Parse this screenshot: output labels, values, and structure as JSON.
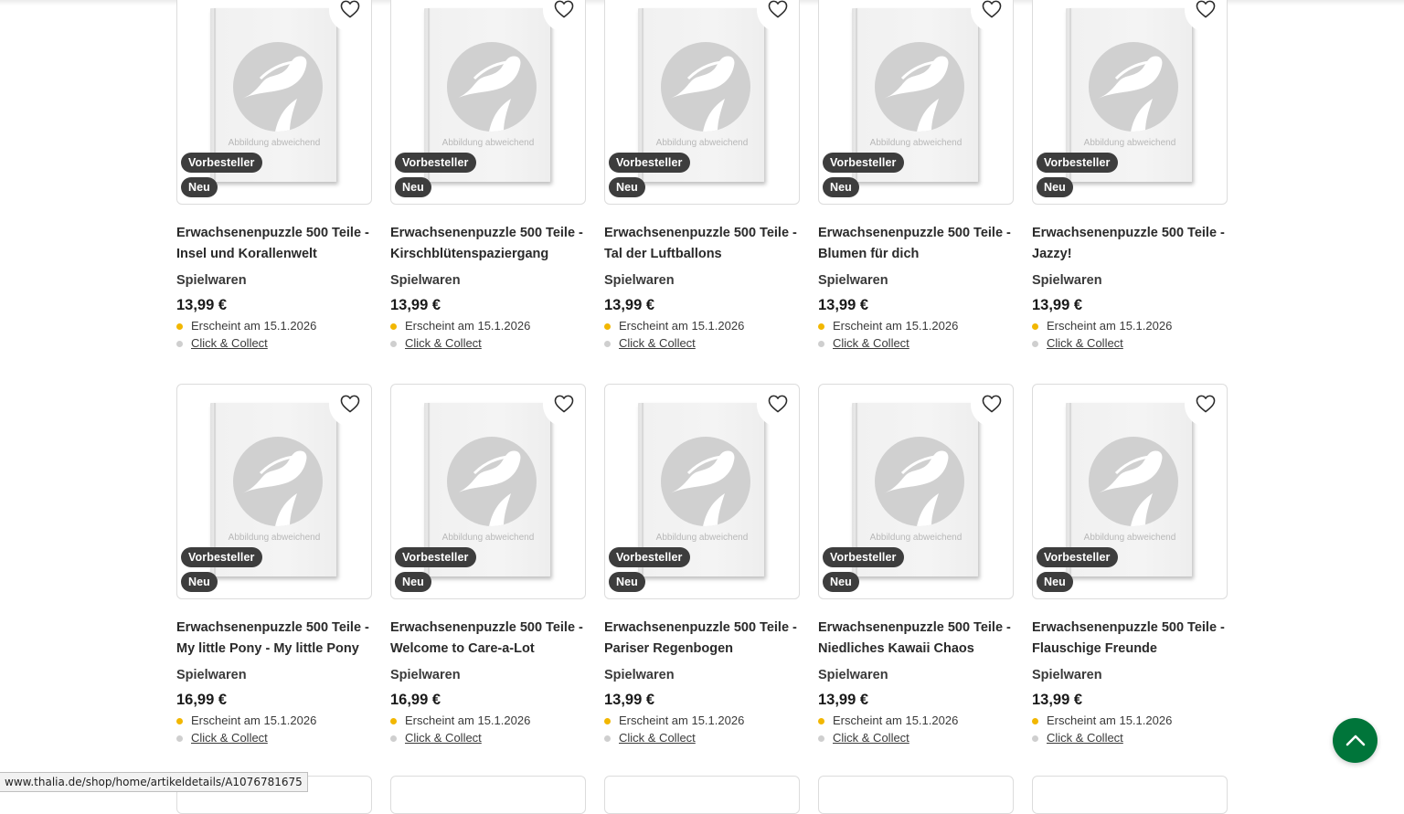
{
  "products": [
    [
      {
        "title": [
          "Erwachsenenpuzzle 500 Teile -",
          "Insel und Korallenwelt"
        ],
        "category": "Spielwaren",
        "price": "13,99 €",
        "availability": "Erscheint am 15.1.2026",
        "collect": "Click & Collect",
        "badges": [
          "Vorbesteller",
          "Neu"
        ],
        "placeholder": "Abbildung abweichend"
      },
      {
        "title": [
          "Erwachsenenpuzzle 500 Teile -",
          "Kirschblütenspaziergang"
        ],
        "category": "Spielwaren",
        "price": "13,99 €",
        "availability": "Erscheint am 15.1.2026",
        "collect": "Click & Collect",
        "badges": [
          "Vorbesteller",
          "Neu"
        ],
        "placeholder": "Abbildung abweichend"
      },
      {
        "title": [
          "Erwachsenenpuzzle 500 Teile -",
          "Tal der Luftballons"
        ],
        "category": "Spielwaren",
        "price": "13,99 €",
        "availability": "Erscheint am 15.1.2026",
        "collect": "Click & Collect",
        "badges": [
          "Vorbesteller",
          "Neu"
        ],
        "placeholder": "Abbildung abweichend"
      },
      {
        "title": [
          "Erwachsenenpuzzle 500 Teile -",
          "Blumen für dich"
        ],
        "category": "Spielwaren",
        "price": "13,99 €",
        "availability": "Erscheint am 15.1.2026",
        "collect": "Click & Collect",
        "badges": [
          "Vorbesteller",
          "Neu"
        ],
        "placeholder": "Abbildung abweichend"
      },
      {
        "title": [
          "Erwachsenenpuzzle 500 Teile -",
          "Jazzy!"
        ],
        "category": "Spielwaren",
        "price": "13,99 €",
        "availability": "Erscheint am 15.1.2026",
        "collect": "Click & Collect",
        "badges": [
          "Vorbesteller",
          "Neu"
        ],
        "placeholder": "Abbildung abweichend"
      }
    ],
    [
      {
        "title": [
          "Erwachsenenpuzzle 500 Teile -",
          "My little Pony - My little Pony"
        ],
        "category": "Spielwaren",
        "price": "16,99 €",
        "availability": "Erscheint am 15.1.2026",
        "collect": "Click & Collect",
        "badges": [
          "Vorbesteller",
          "Neu"
        ],
        "placeholder": "Abbildung abweichend"
      },
      {
        "title": [
          "Erwachsenenpuzzle 500 Teile -",
          "Welcome to Care-a-Lot"
        ],
        "category": "Spielwaren",
        "price": "16,99 €",
        "availability": "Erscheint am 15.1.2026",
        "collect": "Click & Collect",
        "badges": [
          "Vorbesteller",
          "Neu"
        ],
        "placeholder": "Abbildung abweichend"
      },
      {
        "title": [
          "Erwachsenenpuzzle 500 Teile -",
          "Pariser Regenbogen"
        ],
        "category": "Spielwaren",
        "price": "13,99 €",
        "availability": "Erscheint am 15.1.2026",
        "collect": "Click & Collect",
        "badges": [
          "Vorbesteller",
          "Neu"
        ],
        "placeholder": "Abbildung abweichend"
      },
      {
        "title": [
          "Erwachsenenpuzzle 500 Teile -",
          "Niedliches Kawaii Chaos"
        ],
        "category": "Spielwaren",
        "price": "13,99 €",
        "availability": "Erscheint am 15.1.2026",
        "collect": "Click & Collect",
        "badges": [
          "Vorbesteller",
          "Neu"
        ],
        "placeholder": "Abbildung abweichend"
      },
      {
        "title": [
          "Erwachsenenpuzzle 500 Teile -",
          "Flauschige Freunde"
        ],
        "category": "Spielwaren",
        "price": "13,99 €",
        "availability": "Erscheint am 15.1.2026",
        "collect": "Click & Collect",
        "badges": [
          "Vorbesteller",
          "Neu"
        ],
        "placeholder": "Abbildung abweichend"
      }
    ]
  ],
  "icons": {
    "favorite": "heart-outline-icon",
    "scroll_top": "chevron-up-icon",
    "availability_dot": "status-dot-icon",
    "placeholder_logo": "thalia-logo-icon"
  },
  "colors": {
    "scroll_top_bg": "#00753a",
    "badge_bg": "#3d3d3d",
    "availability_dot": "#f2b700",
    "collect_dot": "#cfcfcf"
  },
  "status_bar": {
    "url": "www.thalia.de/shop/home/artikeldetails/A1076781675"
  }
}
